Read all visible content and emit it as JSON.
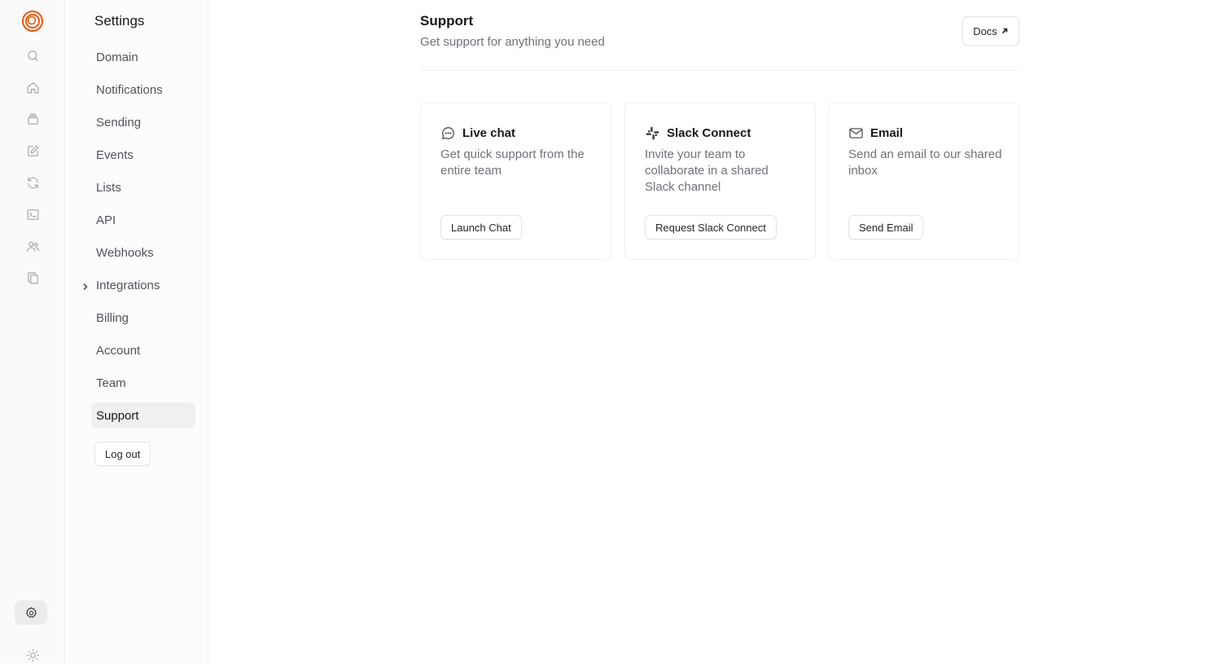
{
  "rail": {
    "icons": [
      "logo-icon",
      "search-icon",
      "home-icon",
      "inbox-icon",
      "edit-icon",
      "refresh-icon",
      "terminal-icon",
      "users-icon",
      "copy-icon",
      "settings-icon",
      "sun-icon"
    ],
    "accent_color": "#ea580c"
  },
  "settings": {
    "title": "Settings",
    "items": [
      {
        "label": "Domain"
      },
      {
        "label": "Notifications"
      },
      {
        "label": "Sending"
      },
      {
        "label": "Events"
      },
      {
        "label": "Lists"
      },
      {
        "label": "API"
      },
      {
        "label": "Webhooks"
      },
      {
        "label": "Integrations"
      },
      {
        "label": "Billing"
      },
      {
        "label": "Account"
      },
      {
        "label": "Team"
      },
      {
        "label": "Support"
      }
    ],
    "active": "Support",
    "logout_label": "Log out"
  },
  "main": {
    "title": "Support",
    "subtitle": "Get support for anything you need",
    "docs_label": "Docs",
    "cards": [
      {
        "title": "Live chat",
        "description": "Get quick support from the entire team",
        "button": "Launch Chat",
        "icon": "chat-icon"
      },
      {
        "title": "Slack Connect",
        "description": "Invite your team to collaborate in a shared Slack channel",
        "button": "Request Slack Connect",
        "icon": "slack-icon"
      },
      {
        "title": "Email",
        "description": "Send an email to our shared inbox",
        "button": "Send Email",
        "icon": "mail-icon"
      }
    ]
  }
}
